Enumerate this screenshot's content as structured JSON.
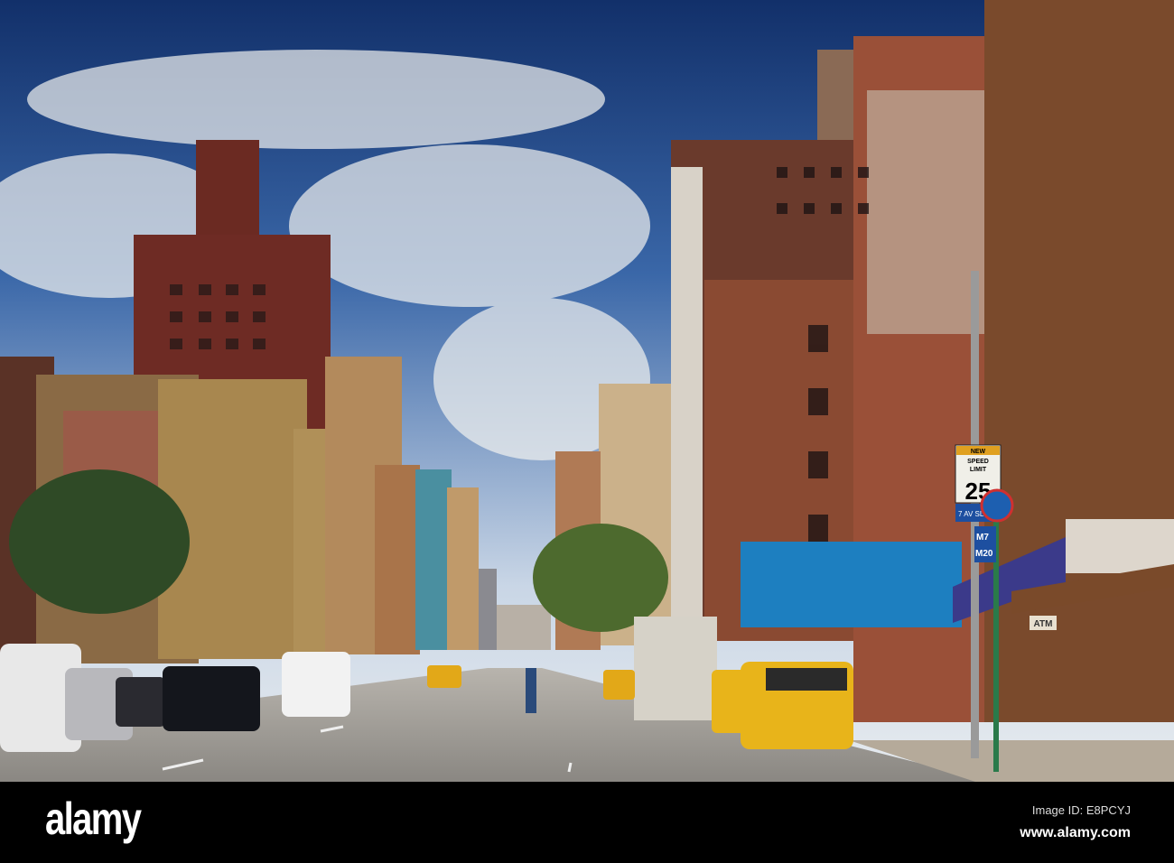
{
  "photo": {
    "subject": "street-scene",
    "signs": {
      "speed_line1": "NEW",
      "speed_line2": "SPEED",
      "speed_line3": "LIMIT",
      "speed_value": "25",
      "street_sign": "7 AV SLOW",
      "bus_route_1": "M7",
      "bus_route_2": "M20",
      "atm": "ATM"
    }
  },
  "footer": {
    "logo": "alamy",
    "image_id": "Image ID: E8PCYJ",
    "website": "www.alamy.com"
  },
  "colors": {
    "sky": "#1f4f8f",
    "brick": "#7a3b2a",
    "taxi": "#e8b41a",
    "footer": "#000000"
  }
}
